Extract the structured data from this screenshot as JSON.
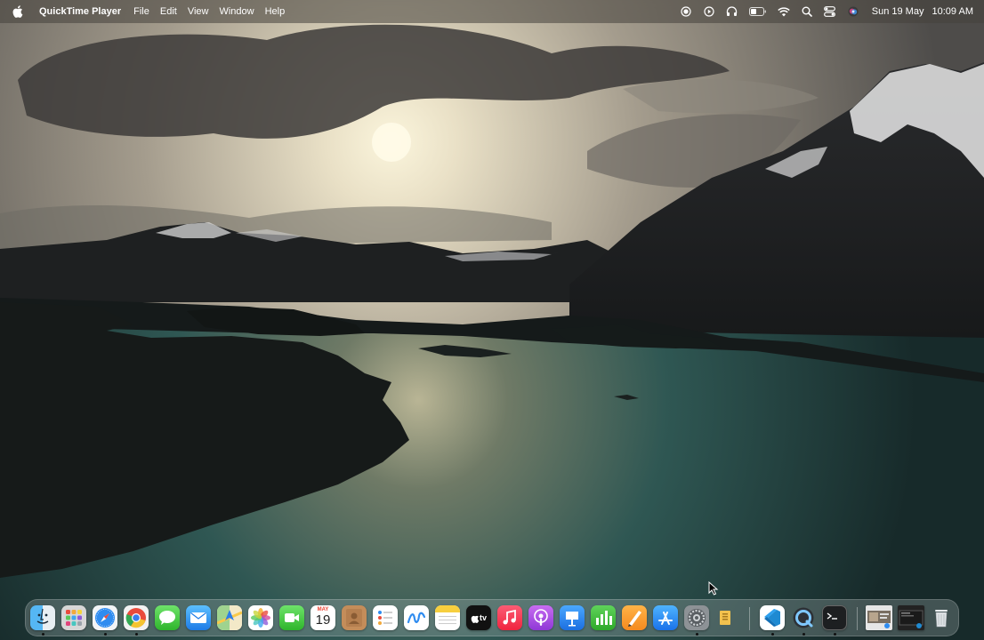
{
  "menubar": {
    "app_name": "QuickTime Player",
    "menus": [
      "File",
      "Edit",
      "View",
      "Window",
      "Help"
    ],
    "status_icons": [
      "screen-record-icon",
      "play-icon",
      "headphones-icon",
      "battery-icon",
      "wifi-icon",
      "search-icon",
      "control-center-icon",
      "siri-icon"
    ],
    "clock": {
      "date": "Sun 19 May",
      "time": "10:09 AM"
    }
  },
  "dock": {
    "apps": [
      {
        "name": "Finder",
        "icon": "finder-icon",
        "running": true
      },
      {
        "name": "Launchpad",
        "icon": "launchpad-icon",
        "running": false
      },
      {
        "name": "Safari",
        "icon": "safari-icon",
        "running": true
      },
      {
        "name": "Google Chrome",
        "icon": "chrome-icon",
        "running": true
      },
      {
        "name": "Messages",
        "icon": "messages-icon",
        "running": false
      },
      {
        "name": "Mail",
        "icon": "mail-icon",
        "running": false
      },
      {
        "name": "Maps",
        "icon": "maps-icon",
        "running": false
      },
      {
        "name": "Photos",
        "icon": "photos-icon",
        "running": false
      },
      {
        "name": "FaceTime",
        "icon": "facetime-icon",
        "running": false
      },
      {
        "name": "Calendar",
        "icon": "calendar-icon",
        "running": false,
        "month": "MAY",
        "day": "19"
      },
      {
        "name": "Contacts",
        "icon": "contacts-icon",
        "running": false
      },
      {
        "name": "Reminders",
        "icon": "reminders-icon",
        "running": false
      },
      {
        "name": "Freeform",
        "icon": "freeform-icon",
        "running": false
      },
      {
        "name": "Notes",
        "icon": "notes-icon",
        "running": false
      },
      {
        "name": "TV",
        "icon": "tv-icon",
        "running": false,
        "label": "tv"
      },
      {
        "name": "Music",
        "icon": "music-icon",
        "running": false
      },
      {
        "name": "Podcasts",
        "icon": "podcasts-icon",
        "running": false
      },
      {
        "name": "Keynote",
        "icon": "keynote-icon",
        "running": false
      },
      {
        "name": "Numbers",
        "icon": "numbers-icon",
        "running": false
      },
      {
        "name": "Pages",
        "icon": "pages-icon",
        "running": false
      },
      {
        "name": "App Store",
        "icon": "app-store-icon",
        "running": false
      },
      {
        "name": "System Settings",
        "icon": "system-settings-icon",
        "running": true
      },
      {
        "name": "Archive Utility",
        "icon": "archive-icon",
        "running": false
      },
      {
        "name": "Visual Studio Code",
        "icon": "vscode-icon",
        "running": true
      },
      {
        "name": "QuickTime Player",
        "icon": "quicktime-icon",
        "running": true
      },
      {
        "name": "Terminal",
        "icon": "terminal-icon",
        "running": true
      },
      {
        "name": "Recent Document",
        "icon": "document-thumbnail-icon",
        "running": false
      },
      {
        "name": "Recent Window",
        "icon": "window-thumbnail-icon",
        "running": false
      },
      {
        "name": "Trash",
        "icon": "trash-icon",
        "running": false
      }
    ]
  },
  "colors": {
    "menubar_text": "#ffffff",
    "lake": "#2f5a56",
    "sky": "#d8d0bd"
  }
}
